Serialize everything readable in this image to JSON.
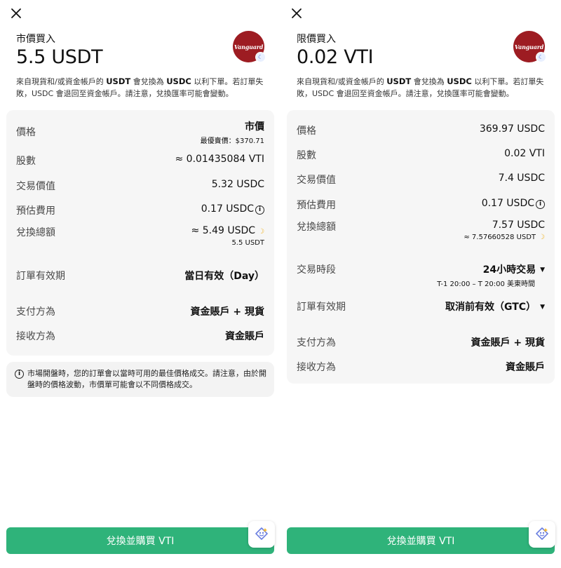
{
  "left": {
    "eyebrow": "市價買入",
    "amount": "5.5 USDT",
    "logo_text": "Vanguard",
    "desc_pre": "來自現貨和/或資金帳戶的 ",
    "desc_from": "USDT",
    "desc_mid": " 會兌換為 ",
    "desc_to": "USDC",
    "desc_post": " 以利下單。若訂單失敗，USDC 會退回至資金帳戶。請注意，兌換匯率可能會變動。",
    "rows": {
      "price_label": "價格",
      "price_value": "市價",
      "price_sub": "最優賣價：$370.71",
      "shares_label": "股數",
      "shares_value": "≈ 0.01435084 VTI",
      "trade_value_label": "交易價值",
      "trade_value_value": "5.32 USDC",
      "fee_label": "預估費用",
      "fee_value": "0.17 USDC",
      "convert_label": "兌換總額",
      "convert_value": "≈ 5.49 USDC",
      "convert_sub": "5.5 USDT",
      "validity_label": "訂單有效期",
      "validity_value": "當日有效（Day）",
      "pay_label": "支付方為",
      "pay_value": "資金賬戶 + 現貨",
      "receive_label": "接收方為",
      "receive_value": "資金賬戶"
    },
    "note": "市場開盤時，您的訂單會以當時可用的最佳價格成交。請注意，由於開盤時的價格波動，市價單可能會以不同價格成交。",
    "cta": "兌換並購買 VTI"
  },
  "right": {
    "eyebrow": "限價買入",
    "amount": "0.02 VTI",
    "logo_text": "Vanguard",
    "desc_pre": "來自現貨和/或資金帳戶的 ",
    "desc_from": "USDT",
    "desc_mid": " 會兌換為 ",
    "desc_to": "USDC",
    "desc_post": " 以利下單。若訂單失敗，USDC 會退回至資金帳戶。請注意，兌換匯率可能會變動。",
    "rows": {
      "price_label": "價格",
      "price_value": "369.97 USDC",
      "shares_label": "股數",
      "shares_value": "0.02 VTI",
      "trade_value_label": "交易價值",
      "trade_value_value": "7.4 USDC",
      "fee_label": "預估費用",
      "fee_value": "0.17 USDC",
      "convert_label": "兌換總額",
      "convert_value": "7.57 USDC",
      "convert_sub": "≈ 7.57660528 USDT",
      "session_label": "交易時段",
      "session_value": "24小時交易",
      "session_sub": "T-1 20:00 – T 20:00 美東時間",
      "validity_label": "訂單有效期",
      "validity_value": "取消前有效（GTC）",
      "pay_label": "支付方為",
      "pay_value": "資金賬戶 + 現貨",
      "receive_label": "接收方為",
      "receive_value": "資金賬戶"
    },
    "cta": "兌換並購買 VTI"
  },
  "colors": {
    "accent": "#2fb37a",
    "logo_bg": "#9d1c22",
    "card_bg": "#f6f6f6"
  },
  "icons": [
    "close-icon",
    "info-icon",
    "sparkle-icon",
    "caret-down-icon",
    "moon-icon",
    "assistant-icon"
  ]
}
